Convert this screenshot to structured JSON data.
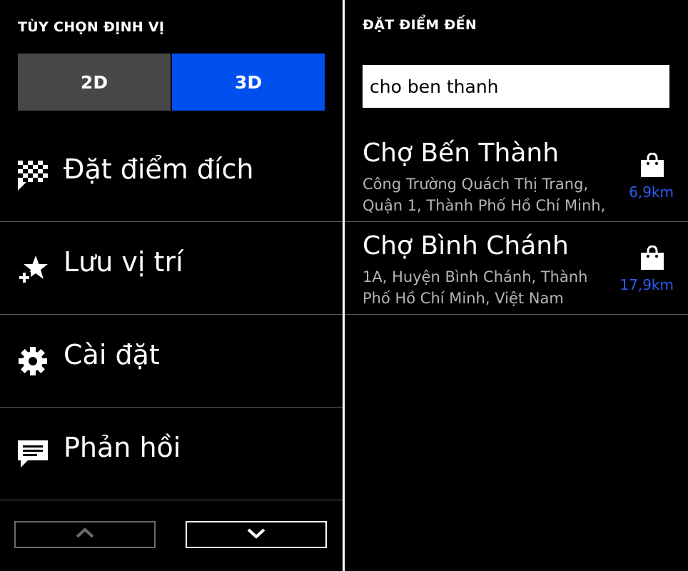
{
  "left": {
    "title": "TÙY CHỌN ĐỊNH VỊ",
    "segment": {
      "option_2d": "2D",
      "option_3d": "3D",
      "selected": "3D"
    },
    "menu": [
      {
        "icon": "checkered-flag-icon",
        "label": "Đặt điểm đích"
      },
      {
        "icon": "star-add-icon",
        "label": "Lưu vị trí"
      },
      {
        "icon": "gear-icon",
        "label": "Cài đặt"
      },
      {
        "icon": "chat-bubble-icon",
        "label": "Phản hồi"
      }
    ],
    "nav": {
      "up_icon": "chevron-up-icon",
      "down_icon": "chevron-down-icon"
    }
  },
  "right": {
    "title": "ĐẶT ĐIỂM ĐẾN",
    "search": {
      "value": "cho ben thanh"
    },
    "results": [
      {
        "name": "Chợ Bến Thành",
        "addr_line1": "Công Trường Quách Thị Trang,",
        "addr_line2": "Quận 1, Thành Phố Hồ Chí Minh,",
        "distance": "6,9km",
        "icon": "shopping-bag-icon"
      },
      {
        "name": "Chợ Bình Chánh",
        "addr_line1": "1A, Huyện Bình Chánh, Thành",
        "addr_line2": "Phố Hồ Chí Minh, Việt Nam",
        "distance": "17,9km",
        "icon": "shopping-bag-icon"
      }
    ]
  },
  "colors": {
    "accent": "#0050ef",
    "segment_inactive": "#474747",
    "distance": "#2b5cf0",
    "background": "#000000"
  }
}
